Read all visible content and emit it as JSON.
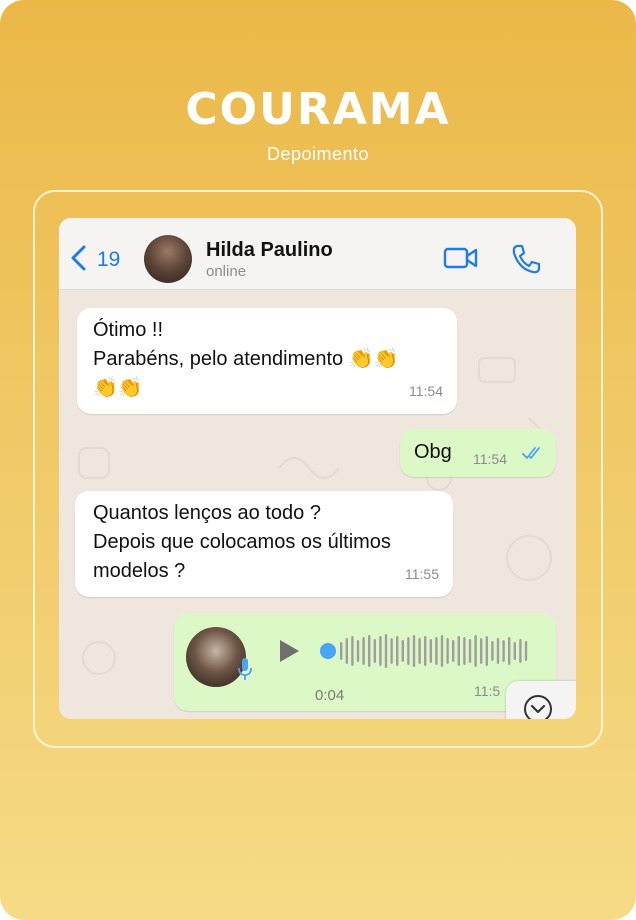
{
  "brand": {
    "name": "COURAMA",
    "subtitle": "Depoimento"
  },
  "header": {
    "back_count": "19",
    "contact_name": "Hilda Paulino",
    "status": "online",
    "icons": [
      "chevron-left-icon",
      "video-camera-icon",
      "phone-icon"
    ],
    "accent_color": "#1d7bea"
  },
  "messages": [
    {
      "direction": "incoming",
      "text": "Ótimo !!\nParabéns, pelo atendimento 👏👏\n👏👏",
      "time": "11:54"
    },
    {
      "direction": "outgoing",
      "text": "Obg",
      "time": "11:54",
      "read": true
    },
    {
      "direction": "incoming",
      "text": "Quantos lenços ao todo ?\nDepois que colocamos os últimos\nmodelos ?",
      "time": "11:55"
    }
  ],
  "voice_note": {
    "duration": "0:04",
    "time": "11:5",
    "progress": 0
  },
  "colors": {
    "background_top": "#ebb848",
    "background_bottom": "#f6db86",
    "outgoing_bubble": "#dcf8c6",
    "incoming_bubble": "#ffffff",
    "read_ticks": "#4aa3f5"
  }
}
